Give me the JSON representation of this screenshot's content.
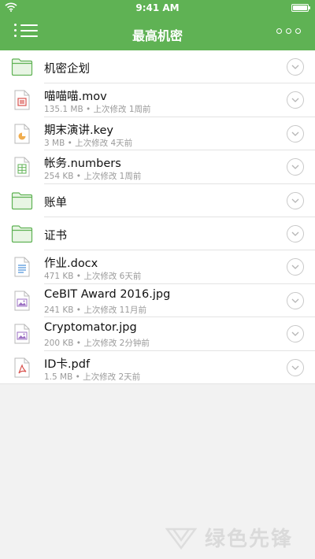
{
  "status_bar": {
    "time": "9:41 AM"
  },
  "navbar": {
    "title": "最高机密"
  },
  "files": [
    {
      "kind": "folder",
      "name": "机密企划"
    },
    {
      "kind": "file",
      "icon": "video-file-icon",
      "name": "喵喵喵.mov",
      "meta": "135.1 MB • 上次修改 1周前"
    },
    {
      "kind": "file",
      "icon": "keynote-file-icon",
      "name": "期末演讲.key",
      "meta": "3 MB • 上次修改 4天前"
    },
    {
      "kind": "file",
      "icon": "spreadsheet-file-icon",
      "name": "帐务.numbers",
      "meta": "254 KB • 上次修改 1周前"
    },
    {
      "kind": "folder",
      "name": "账单"
    },
    {
      "kind": "folder",
      "name": "证书"
    },
    {
      "kind": "file",
      "icon": "document-file-icon",
      "name": "作业.docx",
      "meta": "471 KB • 上次修改 6天前"
    },
    {
      "kind": "file",
      "icon": "image-file-icon",
      "name": "CeBIT Award 2016.jpg",
      "meta": "241 KB • 上次修改 11月前"
    },
    {
      "kind": "file",
      "icon": "image-file-icon",
      "name": "Cryptomator.jpg",
      "meta": "200 KB • 上次修改 2分钟前"
    },
    {
      "kind": "file",
      "icon": "pdf-file-icon",
      "name": "ID卡.pdf",
      "meta": "1.5 MB • 上次修改 2天前"
    }
  ],
  "watermark": {
    "text": "绿色先锋"
  },
  "colors": {
    "accent": "#5fb254",
    "folder_fill": "#e8f5e4",
    "folder_stroke": "#5fb254",
    "separator": "#e3e3e3",
    "background": "#f2f2f2"
  }
}
